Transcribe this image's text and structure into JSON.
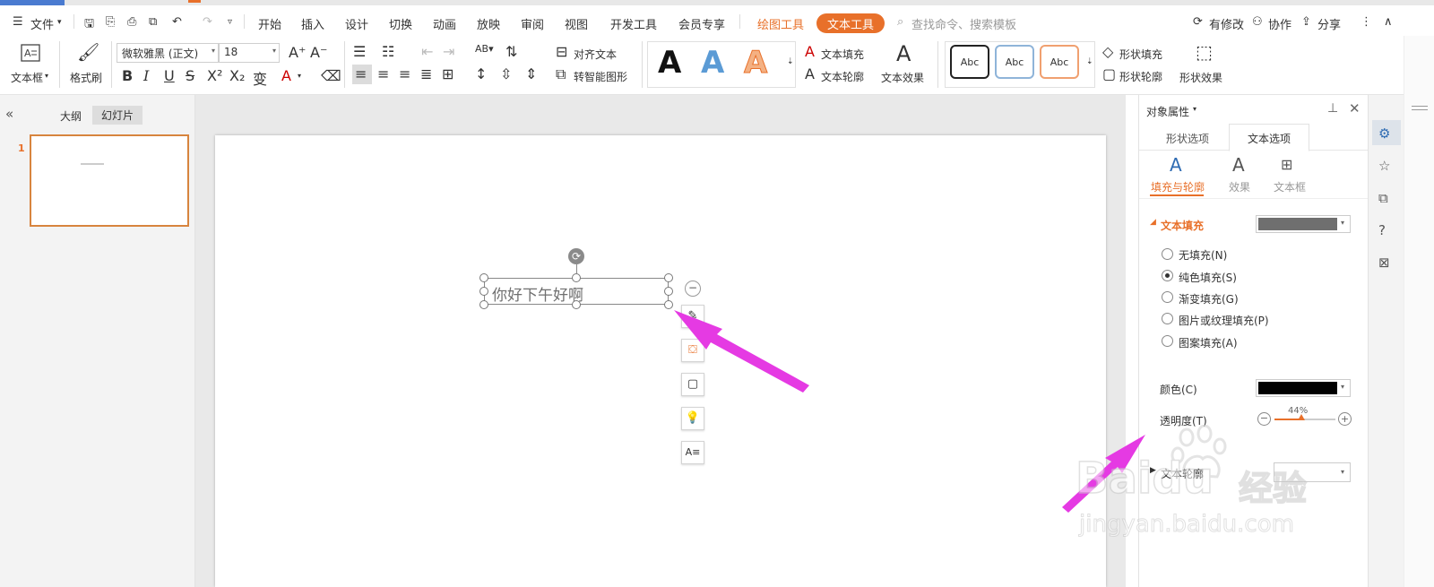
{
  "menubar": {
    "file_label": "文件",
    "tabs": [
      "开始",
      "插入",
      "设计",
      "切换",
      "动画",
      "放映",
      "审阅",
      "视图",
      "开发工具",
      "会员专享"
    ],
    "drawing_tools": "绘图工具",
    "text_tools": "文本工具",
    "search_placeholder": "查找命令、搜索模板",
    "modified_label": "有修改",
    "collab_label": "协作",
    "share_label": "分享"
  },
  "ribbon": {
    "textbox_label": "文本框",
    "format_painter_label": "格式刷",
    "font_name": "微软雅黑 (正文)",
    "font_size": "18",
    "align_text_label": "对齐文本",
    "smart_art_label": "转智能图形",
    "text_fill_label": "文本填充",
    "text_outline_label": "文本轮廓",
    "text_effect_label": "文本效果",
    "shape_fill_label": "形状填充",
    "shape_outline_label": "形状轮廓",
    "shape_effect_label": "形状效果",
    "style_letter": "A",
    "abc_label": "Abc"
  },
  "sidebar": {
    "outline_tab": "大纲",
    "slides_tab": "幻灯片",
    "slide_number": "1"
  },
  "slide": {
    "textbox_text": "你好下午好啊"
  },
  "panel": {
    "title": "对象属性",
    "tab_shape": "形状选项",
    "tab_text": "文本选项",
    "sub_fill": "填充与轮廓",
    "sub_effect": "效果",
    "sub_textbox": "文本框",
    "section_fill": "文本填充",
    "radios": [
      {
        "label": "无填充(N)",
        "selected": false
      },
      {
        "label": "纯色填充(S)",
        "selected": true
      },
      {
        "label": "渐变填充(G)",
        "selected": false
      },
      {
        "label": "图片或纹理填充(P)",
        "selected": false
      },
      {
        "label": "图案填充(A)",
        "selected": false
      }
    ],
    "color_label": "颜色(C)",
    "transparency_label": "透明度(T)",
    "transparency_value": "44%",
    "transparency_fraction": 0.44,
    "outline_section": "文本轮廓"
  },
  "watermark": {
    "brand": "Baidu",
    "suffix": "经验",
    "url": "jingyan.baidu.com"
  },
  "colors": {
    "accent": "#e8702a",
    "arrow": "#e53ae3",
    "fill_swatch": "#6f6f6f",
    "color_swatch": "#000000"
  }
}
